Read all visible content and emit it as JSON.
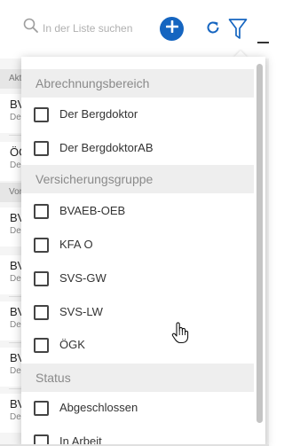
{
  "toolbar": {
    "search_placeholder": "In der Liste suchen",
    "search_icon": "search-icon",
    "add_icon": "plus-icon",
    "refresh_icon": "refresh-icon",
    "filter_icon": "filter-icon",
    "accent_color": "#1565c0"
  },
  "background_list": {
    "sections": [
      "Akt",
      "Vor"
    ],
    "items": [
      {
        "title": "BV",
        "subtitle": "De"
      },
      {
        "title": "ÖG",
        "subtitle": "De"
      },
      {
        "title": "BV",
        "subtitle": "De"
      },
      {
        "title": "BV",
        "subtitle": "De"
      },
      {
        "title": "BV",
        "subtitle": "De"
      },
      {
        "title": "BV",
        "subtitle": "De"
      },
      {
        "title": "BV",
        "subtitle": "De"
      }
    ]
  },
  "filter_menu": {
    "sections": [
      {
        "header": "Abrechnungsbereich",
        "options": [
          {
            "label": "Der Bergdoktor",
            "checked": false
          },
          {
            "label": "Der BergdoktorAB",
            "checked": false
          }
        ]
      },
      {
        "header": "Versicherungsgruppe",
        "options": [
          {
            "label": "BVAEB-OEB",
            "checked": false
          },
          {
            "label": "KFA O",
            "checked": false
          },
          {
            "label": "SVS-GW",
            "checked": false
          },
          {
            "label": "SVS-LW",
            "checked": false
          },
          {
            "label": "ÖGK",
            "checked": false
          }
        ]
      },
      {
        "header": "Status",
        "options": [
          {
            "label": "Abgeschlossen",
            "checked": false
          },
          {
            "label": "In Arbeit",
            "checked": false
          }
        ]
      }
    ]
  },
  "cursor_icon": "hand-pointer-icon"
}
